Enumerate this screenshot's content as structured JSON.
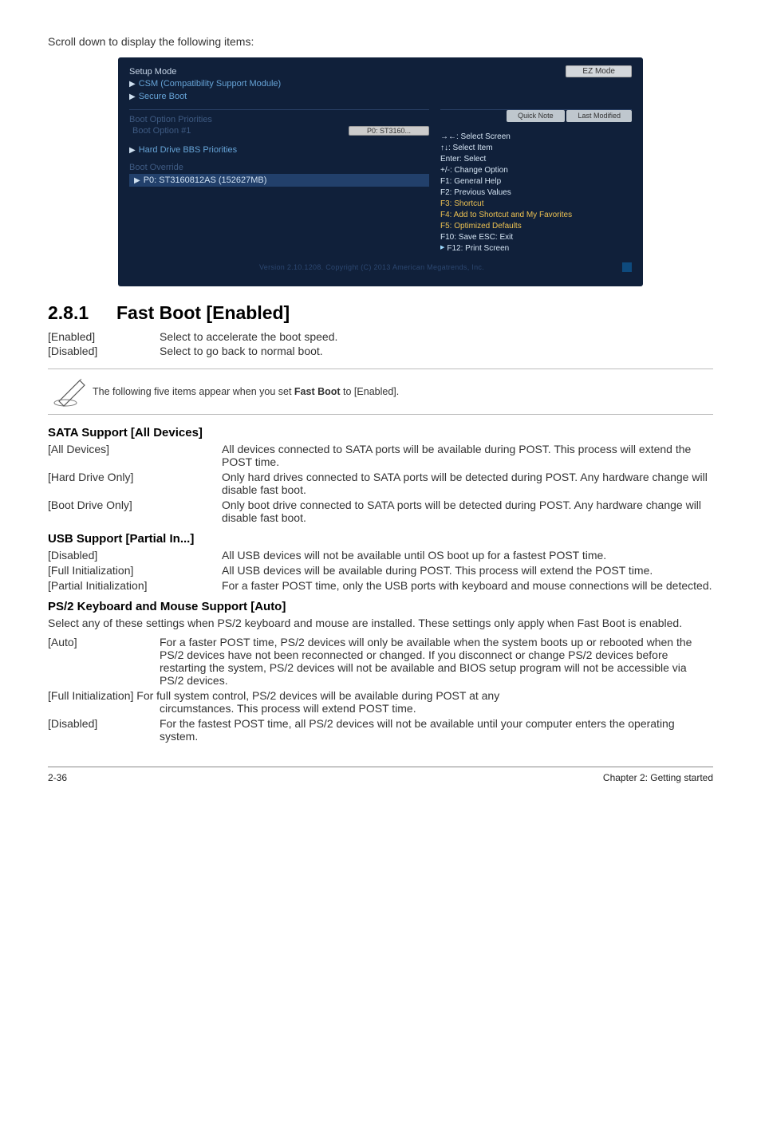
{
  "intro": "Scroll down to display the following items:",
  "bios": {
    "title": "Setup Mode",
    "exit_btn": "EZ Mode",
    "row_csm": "CSM (Compatibility Support Module)",
    "row_secure": "Secure Boot",
    "left": {
      "boot_cfg": "Boot Option Priorities",
      "boot_opt1": "Boot Option #1",
      "opt1_val": "P0: ST3160...",
      "hdd": "Hard Drive BBS Priorities",
      "override": "Boot Override",
      "override_item": "P0: ST3160812AS (152627MB)"
    },
    "tabs": {
      "quick": "Quick Note",
      "last": "Last Modified"
    },
    "side": {
      "l1": "→←: Select Screen",
      "l2": "↑↓: Select Item",
      "l3": "Enter: Select",
      "l4": "+/-: Change Option",
      "l5": "F1: General Help",
      "l6": "F2: Previous Values",
      "l7": "F3: Shortcut",
      "l8": "F4: Add to Shortcut and My Favorites",
      "l9": "F5: Optimized Defaults",
      "l10": "F10: Save   ESC: Exit",
      "l11": "F12: Print Screen"
    },
    "copyright": "Version 2.10.1208. Copyright (C) 2013 American Megatrends, Inc."
  },
  "section": {
    "num": "2.8.1",
    "title": "Fast Boot [Enabled]"
  },
  "fastboot": {
    "enabled_k": "[Enabled]",
    "enabled_v": "Select to accelerate the boot speed.",
    "disabled_k": "[Disabled]",
    "disabled_v": "Select to go back to normal boot."
  },
  "note": {
    "prefix": "The following five items appear when you set ",
    "bold": "Fast Boot",
    "suffix": " to [Enabled]."
  },
  "sata": {
    "head": "SATA Support [All Devices]",
    "all_k": "[All Devices]",
    "all_v": "All devices connected to SATA ports will be available during POST. This process will extend the POST time.",
    "hard_k": "[Hard Drive Only]",
    "hard_v": "Only hard drives connected to SATA ports will be detected during POST. Any hardware change will disable fast boot.",
    "boot_k": "[Boot Drive Only]",
    "boot_v": "Only boot drive connected to SATA ports will be detected during POST. Any hardware change will disable fast boot."
  },
  "usb": {
    "head": "USB Support [Partial In...]",
    "dis_k": "[Disabled]",
    "dis_v": "All USB devices will not be available until OS boot up for a fastest POST time.",
    "full_k": "[Full Initialization]",
    "full_v": "All USB devices will be available during POST. This process will extend the POST time.",
    "part_k": "[Partial Initialization]",
    "part_v": "For a faster POST time, only the USB ports with keyboard and mouse connections will be detected."
  },
  "ps2": {
    "head": "PS/2 Keyboard and Mouse Support [Auto]",
    "intro": "Select any of these settings when PS/2 keyboard and mouse are installed. These settings only apply when Fast Boot is enabled.",
    "auto_k": "[Auto]",
    "auto_v": "For a faster POST time, PS/2 devices will only be available when the system boots up or rebooted when the PS/2 devices have not been reconnected or changed. If you disconnect or change PS/2 devices before restarting the system, PS/2 devices will not be available and BIOS setup program will not be accessible via PS/2 devices.",
    "full_line1": "[Full Initialization] For full system control, PS/2 devices will be available during POST at any",
    "full_line2": "circumstances. This process will extend POST time.",
    "dis_k": "[Disabled]",
    "dis_v": "For the fastest POST time, all PS/2 devices will not be available until your computer enters the operating system."
  },
  "footer": {
    "page": "2-36",
    "chapter": "Chapter 2: Getting started"
  }
}
